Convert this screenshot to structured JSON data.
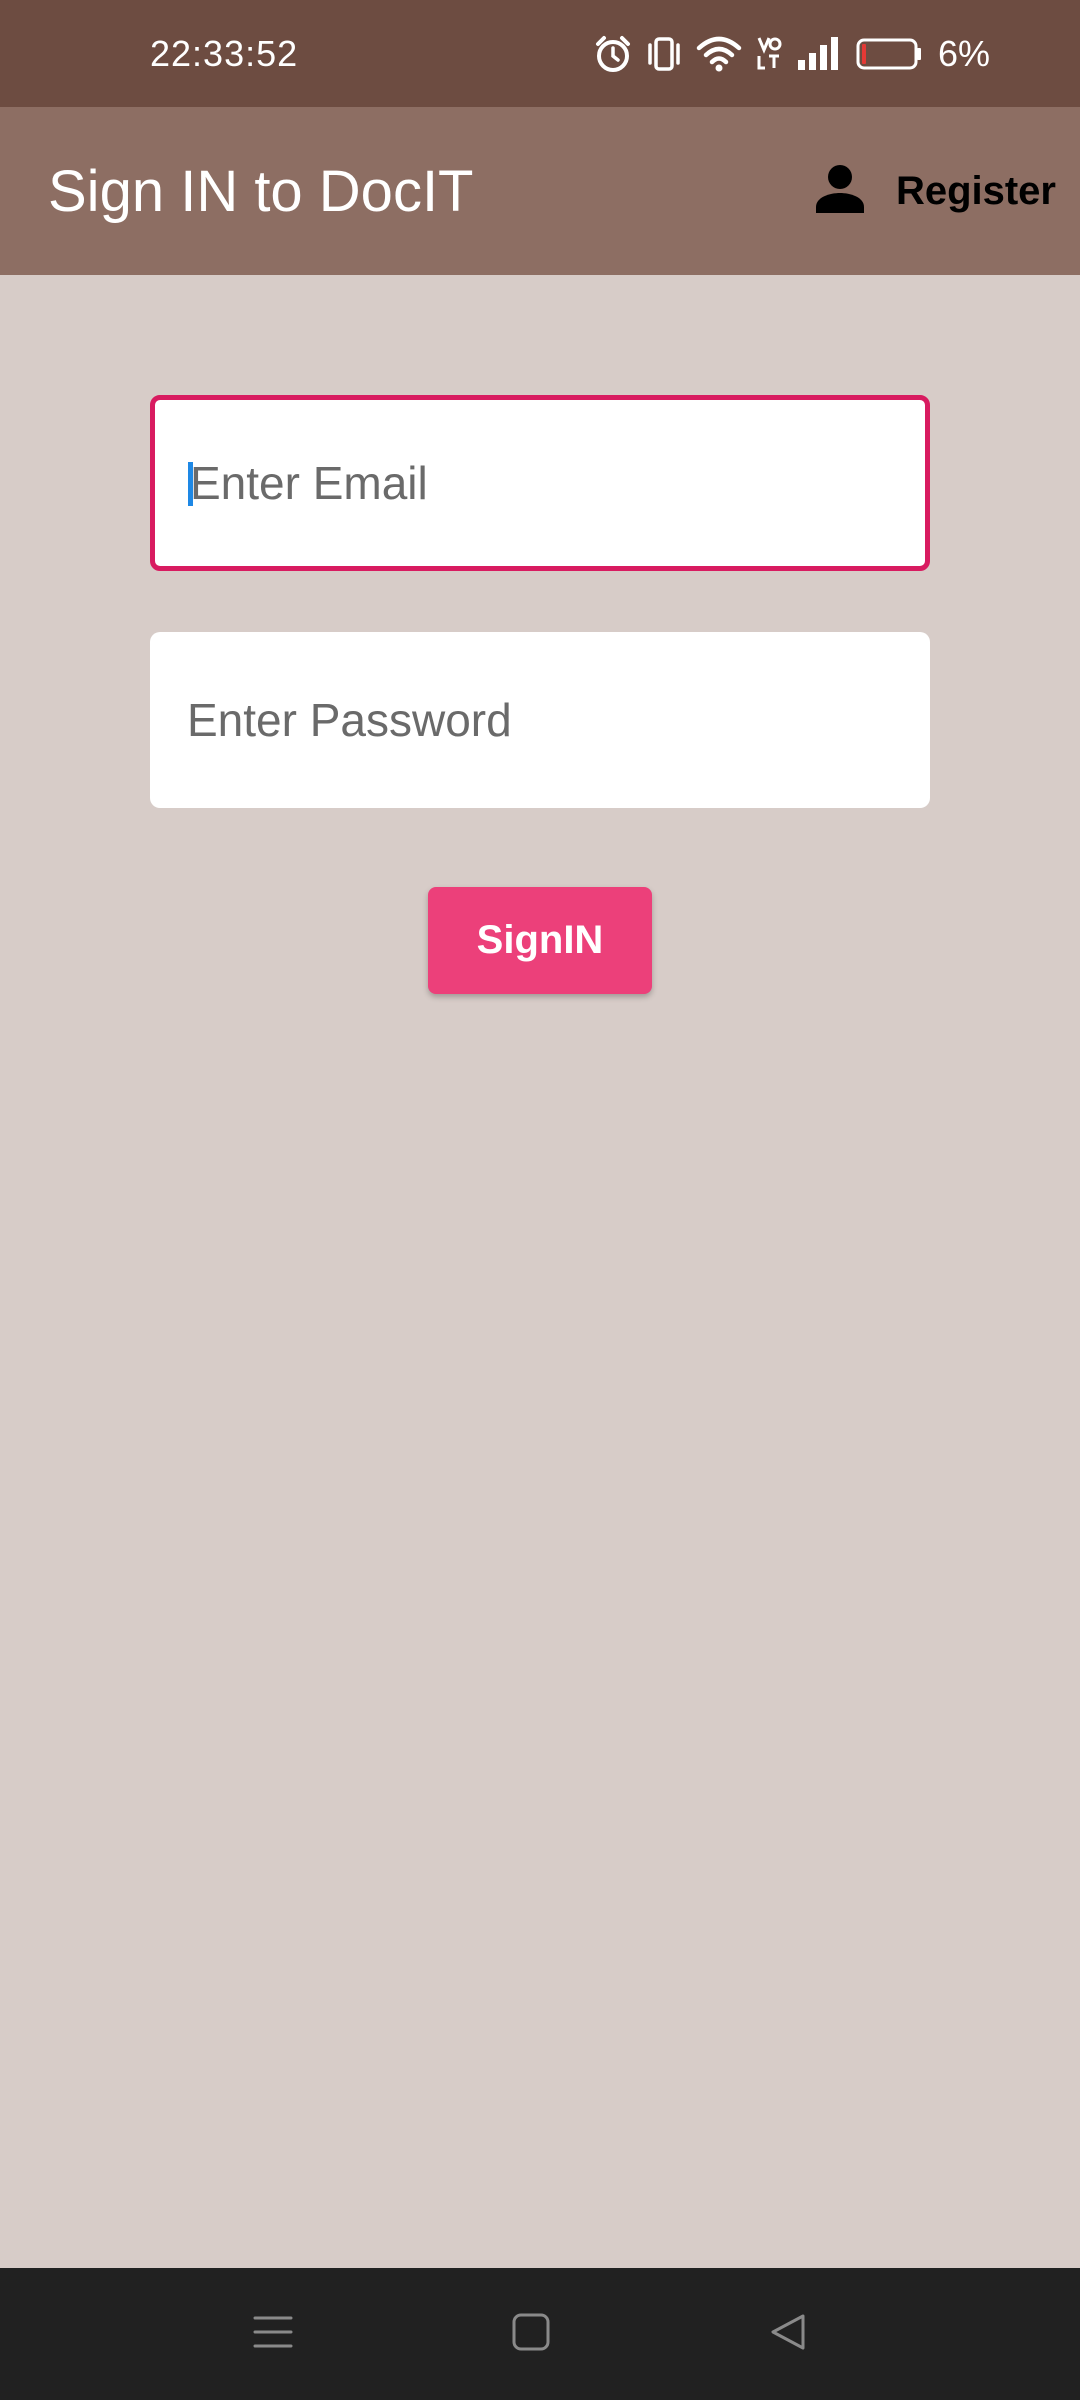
{
  "status_bar": {
    "time": "22:33:52",
    "battery_percent": "6%",
    "icons": [
      "alarm-icon",
      "vibrate-icon",
      "wifi-icon",
      "volte-icon",
      "signal-icon",
      "battery-icon"
    ],
    "battery_level": 0.06
  },
  "app_bar": {
    "title": "Sign IN to DocIT",
    "register_label": "Register",
    "register_icon": "person-icon"
  },
  "form": {
    "email": {
      "placeholder": "Enter Email",
      "value": ""
    },
    "password": {
      "placeholder": "Enter Password",
      "value": ""
    },
    "signin_label": "SignIN"
  },
  "nav_bar": {
    "icons": [
      "menu-icon",
      "home-icon",
      "back-icon"
    ]
  },
  "colors": {
    "status_bar": "#6d4c41",
    "app_bar": "#8d6e63",
    "background": "#d7ccc8",
    "accent": "#ec407a",
    "focus_border": "#d81b60",
    "nav_bar": "#212121"
  }
}
